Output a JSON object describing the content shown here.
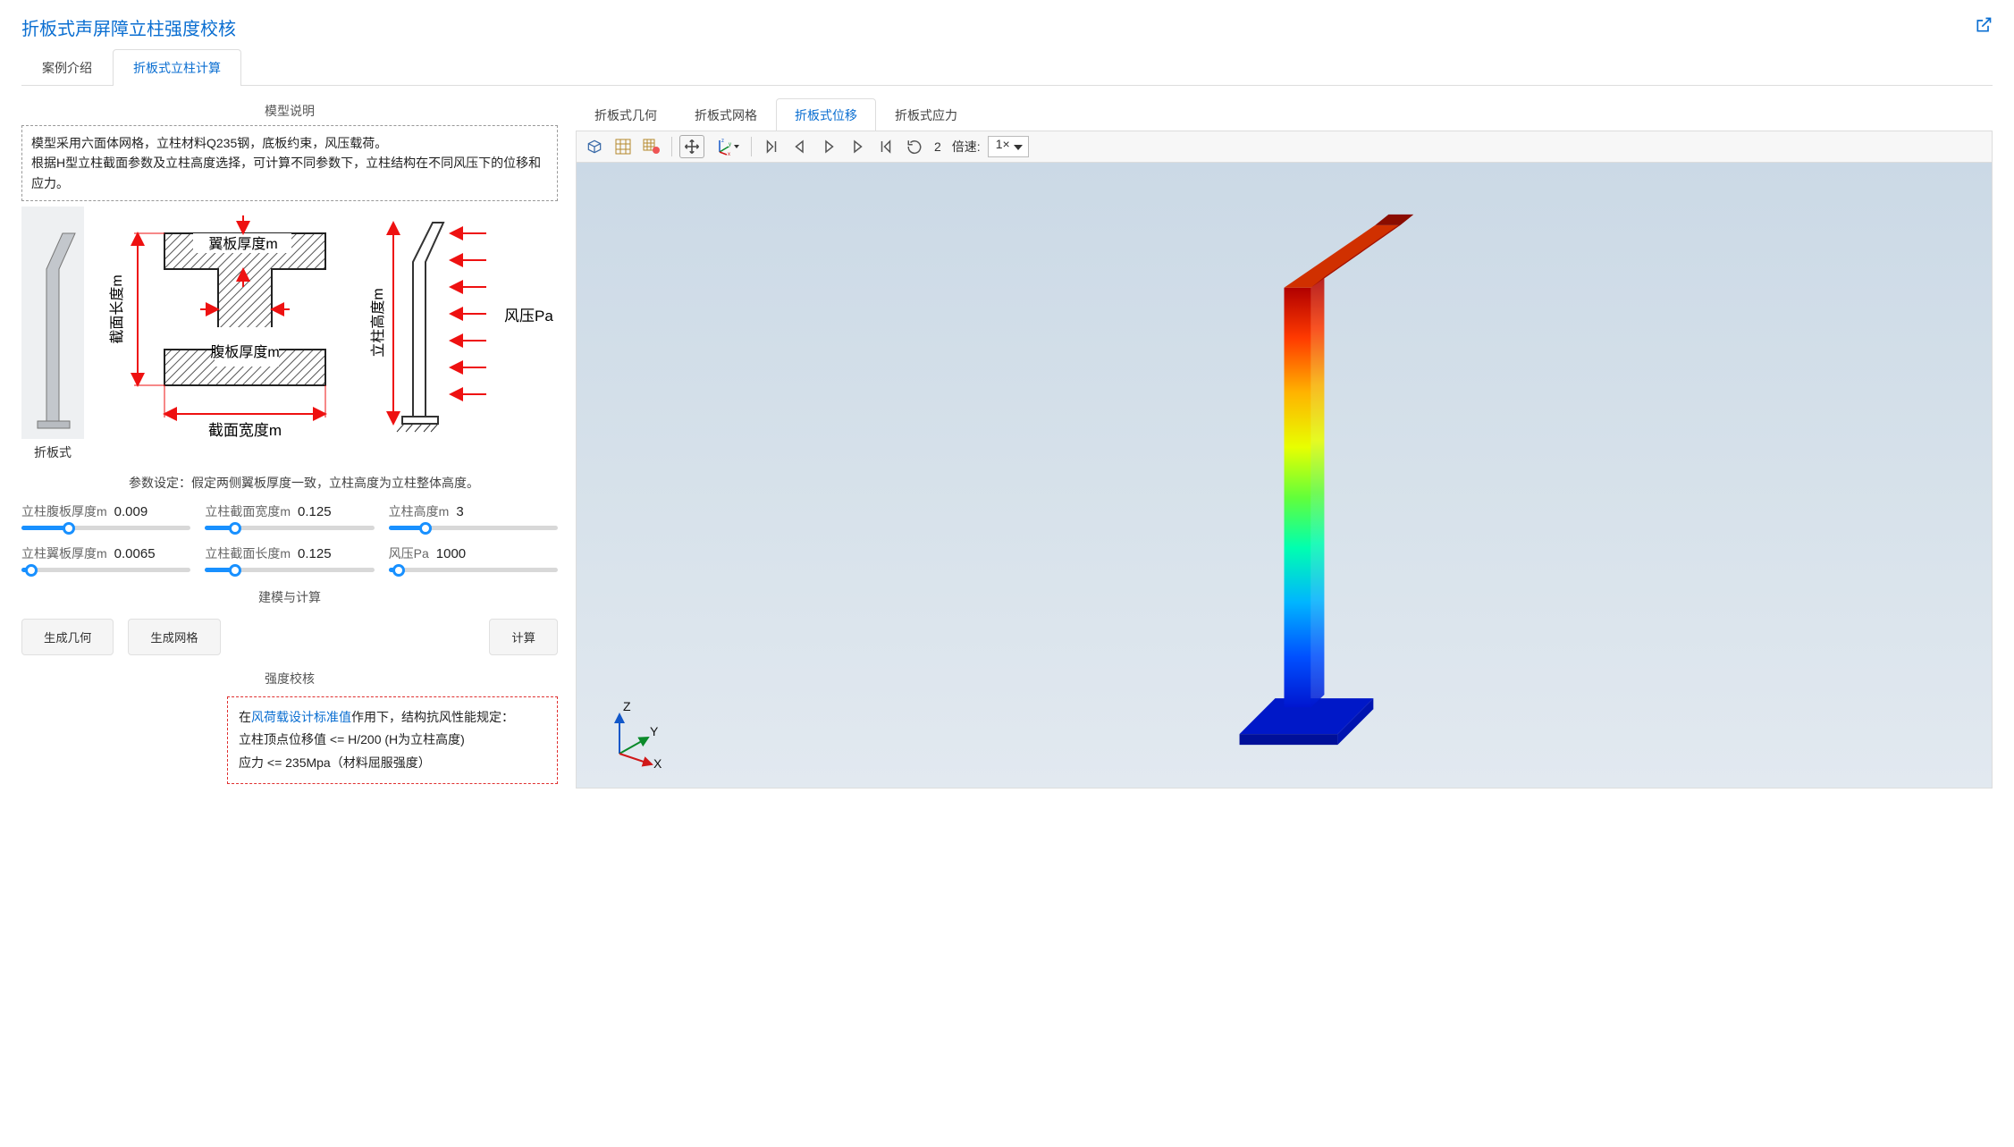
{
  "page": {
    "title": "折板式声屏障立柱强度校核"
  },
  "tabs": {
    "main": [
      {
        "label": "案例介绍",
        "active": false
      },
      {
        "label": "折板式立柱计算",
        "active": true
      }
    ]
  },
  "model_desc": {
    "heading": "模型说明",
    "line1": "模型采用六面体网格，立柱材料Q235钢，底板约束，风压载荷。",
    "line2": "根据H型立柱截面参数及立柱高度选择，可计算不同参数下，立柱结构在不同风压下的位移和应力。"
  },
  "diagram": {
    "mini_label": "折板式",
    "h_section": {
      "flange": "翼板厚度m",
      "web": "腹板厚度m",
      "length": "截面长度m",
      "width": "截面宽度m"
    },
    "pillar": {
      "height": "立柱高度m",
      "load": "风压Pa"
    }
  },
  "param_note": "参数设定：假定两侧翼板厚度一致，立柱高度为立柱整体高度。",
  "sliders": [
    {
      "id": "web_thk",
      "label": "立柱腹板厚度m",
      "value": "0.009",
      "pct": 28
    },
    {
      "id": "sec_width",
      "label": "立柱截面宽度m",
      "value": "0.125",
      "pct": 18
    },
    {
      "id": "height",
      "label": "立柱高度m",
      "value": "3",
      "pct": 22
    },
    {
      "id": "flange_thk",
      "label": "立柱翼板厚度m",
      "value": "0.0065",
      "pct": 6
    },
    {
      "id": "sec_len",
      "label": "立柱截面长度m",
      "value": "0.125",
      "pct": 18
    },
    {
      "id": "wind_p",
      "label": "风压Pa",
      "value": "1000",
      "pct": 6
    }
  ],
  "build_heading": "建模与计算",
  "buttons": {
    "gen_geom": "生成几何",
    "gen_mesh": "生成网格",
    "compute": "计算"
  },
  "strength_check": {
    "heading": "强度校核",
    "pre": "在",
    "link": "风荷载设计标准值",
    "post": "作用下，结构抗风性能规定：",
    "line2": "立柱顶点位移值 <= H/200 (H为立柱高度)",
    "line3": "应力 <= 235Mpa（材料屈服强度）"
  },
  "viewer": {
    "tabs": [
      {
        "label": "折板式几何",
        "active": false
      },
      {
        "label": "折板式网格",
        "active": false
      },
      {
        "label": "折板式位移",
        "active": true
      },
      {
        "label": "折板式应力",
        "active": false
      }
    ],
    "toolbar": {
      "frame": "2",
      "speed_label": "倍速:",
      "speed_value": "1×"
    },
    "triad": {
      "x": "X",
      "y": "Y",
      "z": "Z"
    }
  },
  "icons": {
    "open_external": "open-external-icon",
    "cube": "cube-icon",
    "grid": "grid-icon",
    "grid_opts": "grid-options-icon",
    "move": "move-icon",
    "axes_dd": "axes-dropdown-icon",
    "first": "go-first-icon",
    "prev": "go-prev-icon",
    "play": "play-icon",
    "next": "go-next-icon",
    "last": "go-last-icon",
    "loop": "loop-icon"
  }
}
